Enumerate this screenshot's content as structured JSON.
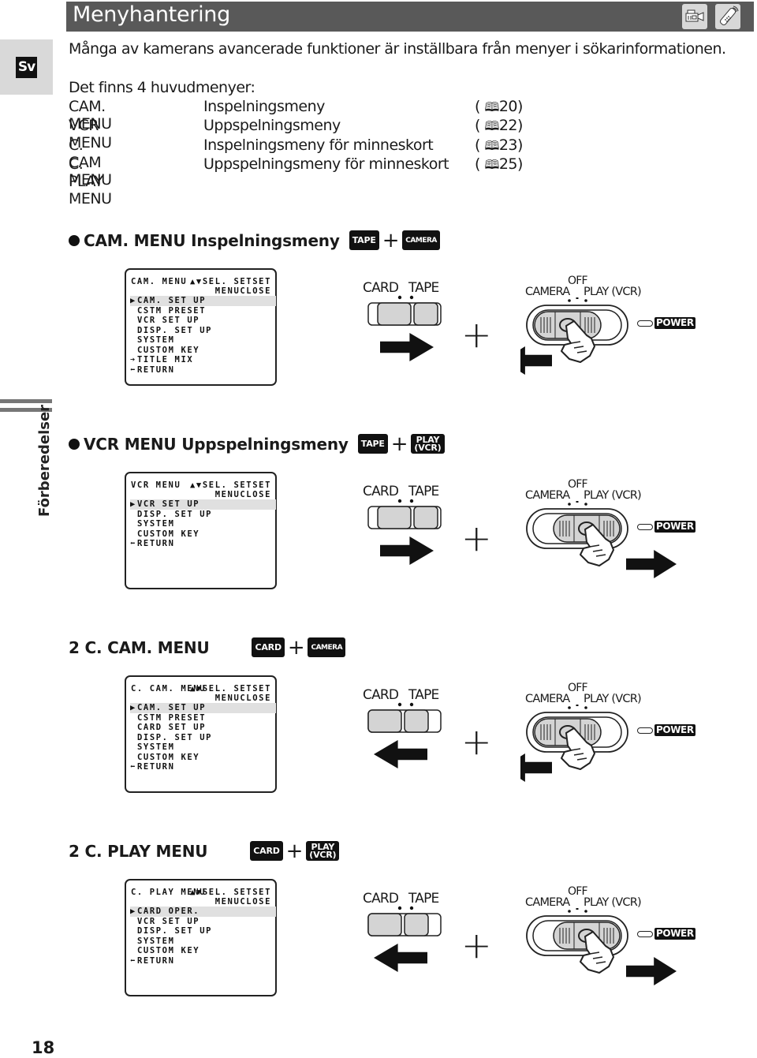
{
  "header": {
    "title": "Menyhantering",
    "icons": [
      "camcorder-icon",
      "remote-control-icon"
    ]
  },
  "language_tab": "Sv",
  "side_label": "Förberedelser",
  "intro": "Många av kamerans avancerade funktioner är inställbara från menyer i sökarinformationen.",
  "menus_overview": {
    "heading": "Det finns 4 huvudmenyer:",
    "rows": [
      {
        "name": "CAM. MENU",
        "desc": "Inspelningsmeny",
        "ref": "20"
      },
      {
        "name": "VCR MENU",
        "desc": "Uppspelningsmeny",
        "ref": "22"
      },
      {
        "name": "C. CAM MENU",
        "desc": "Inspelningsmeny för minneskort",
        "ref": "23"
      },
      {
        "name": "C. PLAY MENU",
        "desc": "Uppspelningsmeny för minneskort",
        "ref": "25"
      }
    ],
    "ref_open": "(",
    "ref_close": ")"
  },
  "sections": [
    {
      "heading": "CAM. MENU Inspelningsmeny",
      "bullet": true,
      "badge1": "TAPE",
      "badge2": [
        "CAMERA"
      ],
      "lcd": {
        "title": "CAM. MENU",
        "sel": "▲▼SEL. SETSET",
        "close": "MENUCLOSE",
        "items": [
          "▶CAM. SET UP",
          "CSTM PRESET",
          "VCR SET UP",
          "DISP. SET UP",
          "SYSTEM",
          "CUSTOM KEY",
          "➔TITLE MIX",
          "⬅RETURN"
        ]
      },
      "media_switch": {
        "card": "CARD",
        "tape": "TAPE",
        "position": "tape",
        "arrow": "right"
      },
      "power_dial": {
        "off": "OFF",
        "camera": "CAMERA",
        "play": "PLAY (VCR)",
        "position": "camera",
        "arrow": "left",
        "power": "POWER"
      }
    },
    {
      "heading": "VCR MENU Uppspelningsmeny",
      "bullet": true,
      "badge1": "TAPE",
      "badge2": [
        "PLAY",
        "(VCR)"
      ],
      "lcd": {
        "title": "VCR MENU",
        "sel": "▲▼SEL. SETSET",
        "close": "MENUCLOSE",
        "items": [
          "▶VCR SET UP",
          "DISP. SET UP",
          "SYSTEM",
          "CUSTOM KEY",
          "⬅RETURN"
        ]
      },
      "media_switch": {
        "card": "CARD",
        "tape": "TAPE",
        "position": "tape",
        "arrow": "right"
      },
      "power_dial": {
        "off": "OFF",
        "camera": "CAMERA",
        "play": "PLAY (VCR)",
        "position": "play",
        "arrow": "right",
        "power": "POWER"
      }
    },
    {
      "heading": "2 C. CAM. MENU",
      "bullet": false,
      "badge1": "CARD",
      "badge2": [
        "CAMERA"
      ],
      "lcd": {
        "title": "C. CAM. MENU",
        "sel": "▲▼SEL. SETSET",
        "close": "MENUCLOSE",
        "items": [
          "▶CAM. SET UP",
          "CSTM PRESET",
          "CARD SET UP",
          "DISP. SET UP",
          "SYSTEM",
          "CUSTOM KEY",
          "⬅RETURN"
        ]
      },
      "media_switch": {
        "card": "CARD",
        "tape": "TAPE",
        "position": "card",
        "arrow": "left"
      },
      "power_dial": {
        "off": "OFF",
        "camera": "CAMERA",
        "play": "PLAY (VCR)",
        "position": "camera",
        "arrow": "left",
        "power": "POWER"
      }
    },
    {
      "heading": "2 C. PLAY MENU",
      "bullet": false,
      "badge1": "CARD",
      "badge2": [
        "PLAY",
        "(VCR)"
      ],
      "lcd": {
        "title": "C. PLAY MENU",
        "sel": "▲▼SEL. SETSET",
        "close": "MENUCLOSE",
        "items": [
          "▶CARD OPER.",
          "VCR SET UP",
          "DISP. SET UP",
          "SYSTEM",
          "CUSTOM KEY",
          "⬅RETURN"
        ]
      },
      "media_switch": {
        "card": "CARD",
        "tape": "TAPE",
        "position": "card",
        "arrow": "left"
      },
      "power_dial": {
        "off": "OFF",
        "camera": "CAMERA",
        "play": "PLAY (VCR)",
        "position": "play",
        "arrow": "right",
        "power": "POWER"
      }
    }
  ],
  "page_number": "18",
  "colors": {
    "header_bg": "#595959",
    "tab_bg": "#d9d9d9",
    "badge_bg": "#111111",
    "highlight": "#e0e0e0"
  }
}
